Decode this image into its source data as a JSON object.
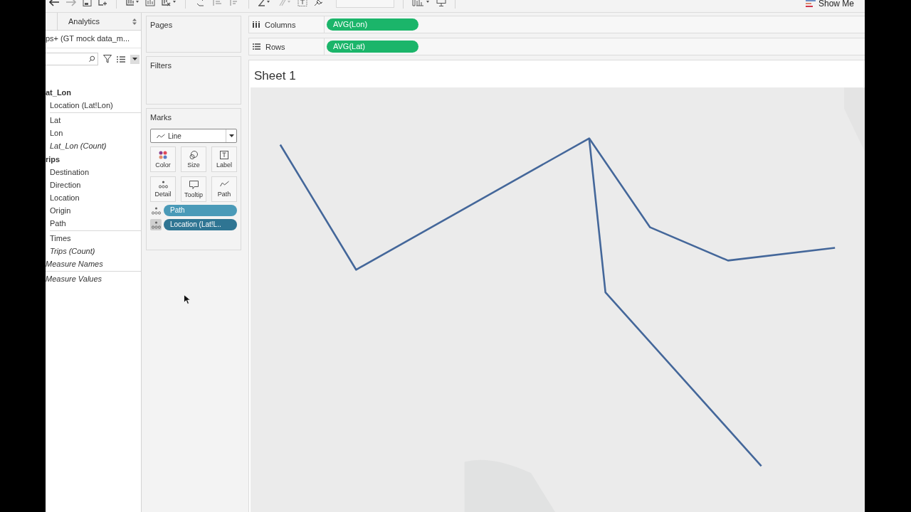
{
  "toolbar": {
    "show_me": "Show Me"
  },
  "data_pane": {
    "tabs": [
      {
        "label": "Analytics",
        "selected": false
      }
    ],
    "datasource": "ps+ (GT mock data_m...",
    "sections": [
      {
        "header": "at_Lon",
        "groups": [
          [
            {
              "name": "Location (Lat!Lon)",
              "kind": "field"
            }
          ],
          [
            {
              "name": "Lat",
              "kind": "field"
            },
            {
              "name": "Lon",
              "kind": "field"
            },
            {
              "name": "Lat_Lon (Count)",
              "kind": "count"
            }
          ]
        ]
      },
      {
        "header": "rips",
        "groups": [
          [
            {
              "name": "Destination",
              "kind": "field"
            },
            {
              "name": "Direction",
              "kind": "field"
            },
            {
              "name": "Location",
              "kind": "field"
            },
            {
              "name": "Origin",
              "kind": "field"
            },
            {
              "name": "Path",
              "kind": "field"
            }
          ],
          [
            {
              "name": "Times",
              "kind": "field"
            },
            {
              "name": "Trips (Count)",
              "kind": "count"
            }
          ]
        ]
      },
      {
        "groups": [
          [
            {
              "name": "Measure Names",
              "kind": "special"
            }
          ],
          [
            {
              "name": "Measure Values",
              "kind": "special"
            }
          ]
        ]
      }
    ]
  },
  "cards": {
    "pages": "Pages",
    "filters": "Filters",
    "marks": {
      "title": "Marks",
      "mark_type": "Line",
      "buttons": [
        {
          "label": "Color",
          "kind": "color"
        },
        {
          "label": "Size",
          "kind": "size"
        },
        {
          "label": "Label",
          "kind": "label"
        },
        {
          "label": "Detail",
          "kind": "detail"
        },
        {
          "label": "Tooltip",
          "kind": "tooltip"
        },
        {
          "label": "Path",
          "kind": "path"
        }
      ],
      "pills": [
        {
          "label": "Path",
          "color": "#4a9ab8",
          "selected": false
        },
        {
          "label": "Location (Lat!L..",
          "color": "#2f7593",
          "selected": true
        }
      ]
    }
  },
  "shelves": [
    {
      "label": "Columns",
      "kind": "columns",
      "pill": "AVG(Lon)"
    },
    {
      "label": "Rows",
      "kind": "rows",
      "pill": "AVG(Lat)"
    }
  ],
  "sheet": {
    "title": "Sheet 1"
  }
}
